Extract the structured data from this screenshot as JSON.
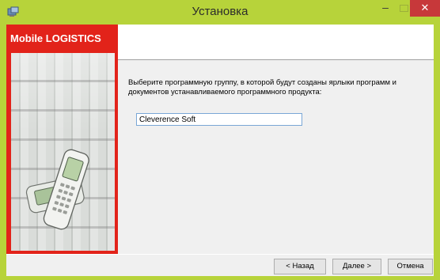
{
  "window": {
    "title": "Установка",
    "min_glyph": "–",
    "close_glyph": "✕"
  },
  "banner": {
    "brand": "Mobile LOGISTICS",
    "brand_color": "#e2231a"
  },
  "main": {
    "instructions": "Выберите программную группу, в которой будут созданы ярлыки программ и документов устанавливаемого программного продукта:",
    "group_value": "Cleverence Soft"
  },
  "buttons": {
    "back": "< Назад",
    "next": "Далее >",
    "cancel": "Отмена"
  },
  "colors": {
    "frame": "#b7d33a",
    "close": "#c7383a"
  }
}
